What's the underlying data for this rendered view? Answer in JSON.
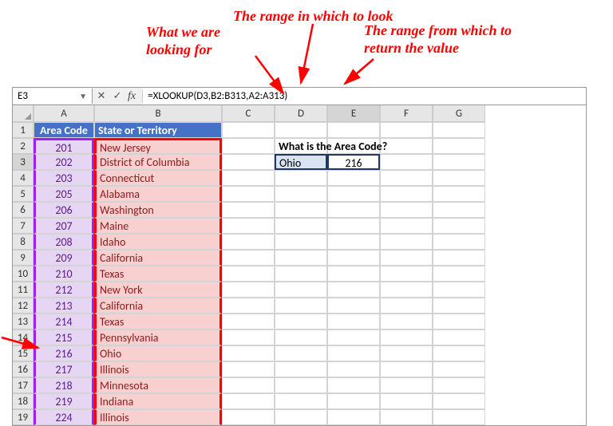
{
  "annotations": {
    "lookup_for": "What we are\nlooking for",
    "range_look": "The range in which to look",
    "range_return": "The range from which to\nreturn the value"
  },
  "namebox": "E3",
  "fx": "fx",
  "formula": "=XLOOKUP(D3,B2:B313,A2:A313)",
  "cols": [
    "A",
    "B",
    "C",
    "D",
    "E",
    "F",
    "G"
  ],
  "rows": [
    "1",
    "2",
    "3",
    "4",
    "5",
    "6",
    "7",
    "8",
    "9",
    "10",
    "11",
    "12",
    "13",
    "14",
    "15",
    "16",
    "17",
    "18",
    "19"
  ],
  "headers": {
    "area": "Area Code",
    "state": "State or Territory"
  },
  "data_rows": [
    {
      "code": "201",
      "state": "New Jersey"
    },
    {
      "code": "202",
      "state": "District of Columbia"
    },
    {
      "code": "203",
      "state": "Connecticut"
    },
    {
      "code": "205",
      "state": "Alabama"
    },
    {
      "code": "206",
      "state": "Washington"
    },
    {
      "code": "207",
      "state": "Maine"
    },
    {
      "code": "208",
      "state": "Idaho"
    },
    {
      "code": "209",
      "state": "California"
    },
    {
      "code": "210",
      "state": "Texas"
    },
    {
      "code": "212",
      "state": "New York"
    },
    {
      "code": "213",
      "state": "California"
    },
    {
      "code": "214",
      "state": "Texas"
    },
    {
      "code": "215",
      "state": "Pennsylvania"
    },
    {
      "code": "216",
      "state": "Ohio"
    },
    {
      "code": "217",
      "state": "Illinois"
    },
    {
      "code": "218",
      "state": "Minnesota"
    },
    {
      "code": "219",
      "state": "Indiana"
    },
    {
      "code": "224",
      "state": "Illinois"
    }
  ],
  "prompt": "What is the Area Code?",
  "lookup_value": "Ohio",
  "result": "216"
}
